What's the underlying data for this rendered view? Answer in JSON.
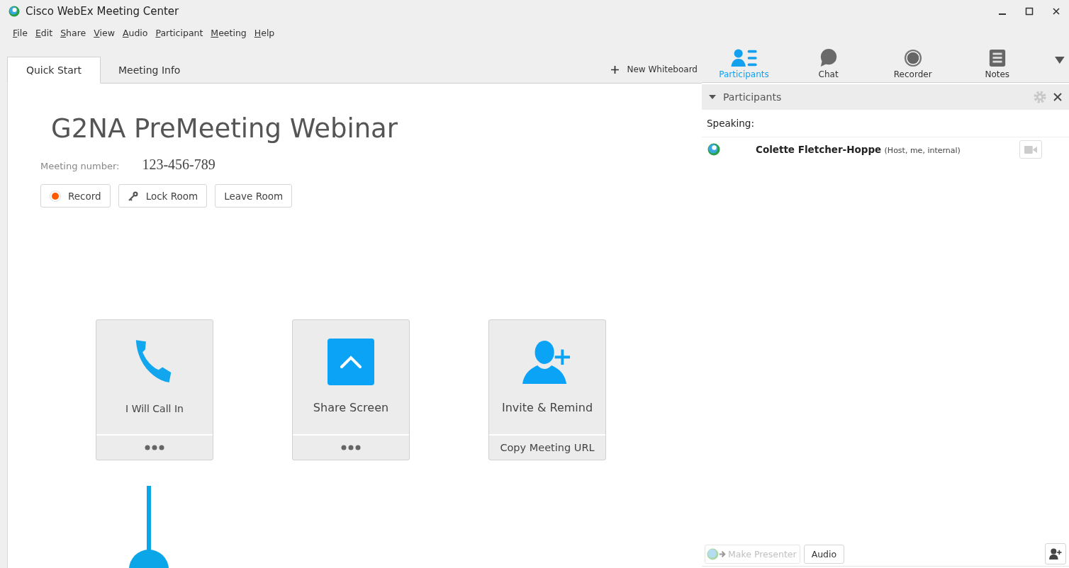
{
  "window": {
    "title": "Cisco WebEx Meeting Center"
  },
  "menu": [
    "File",
    "Edit",
    "Share",
    "View",
    "Audio",
    "Participant",
    "Meeting",
    "Help"
  ],
  "tabs": [
    {
      "label": "Quick Start",
      "selected": true
    },
    {
      "label": "Meeting Info",
      "selected": false
    }
  ],
  "new_whiteboard": "New Whiteboard",
  "meeting": {
    "title": "G2NA PreMeeting Webinar",
    "number_label": "Meeting number:",
    "number": "123-456-789"
  },
  "actions": [
    {
      "kind": "record",
      "label": "Record",
      "color": "#ff5a00"
    },
    {
      "kind": "lock",
      "label": "Lock Room"
    },
    {
      "kind": "leave",
      "label": "Leave Room"
    }
  ],
  "cards": [
    {
      "kind": "phone",
      "label": "I Will Call In"
    },
    {
      "kind": "share",
      "label": "Share Screen"
    },
    {
      "kind": "invite",
      "label": "Invite & Remind",
      "footer": "Copy Meeting URL"
    }
  ],
  "panel_tabs": [
    {
      "kind": "participants",
      "label": "Participants",
      "selected": true
    },
    {
      "kind": "chat",
      "label": "Chat",
      "selected": false
    },
    {
      "kind": "recorder",
      "label": "Recorder",
      "selected": false
    },
    {
      "kind": "notes",
      "label": "Notes",
      "selected": false
    }
  ],
  "panel": {
    "title": "Participants",
    "expanded": true,
    "speaking_label": "Speaking:",
    "participants": [
      {
        "name": "Colette Fletcher-Hoppe",
        "role": "(Host, me, internal)"
      }
    ]
  },
  "footer": {
    "make_presenter": {
      "label": "Make Presenter",
      "disabled": true
    },
    "audio": "Audio"
  }
}
